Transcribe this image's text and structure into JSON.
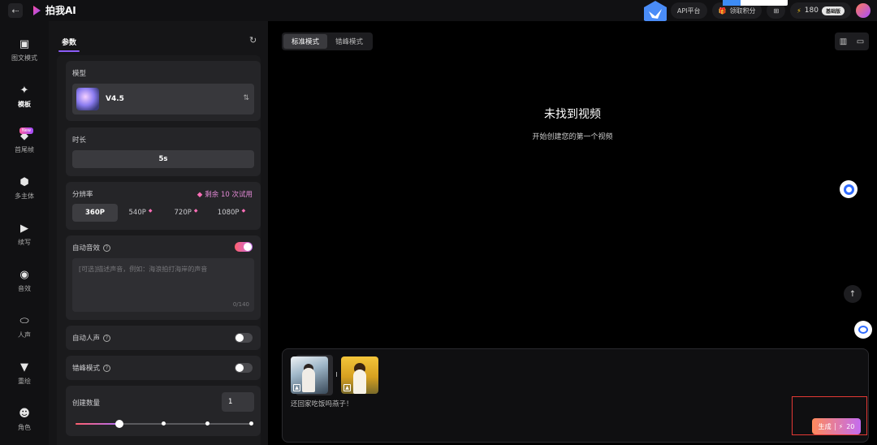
{
  "app": {
    "title": "拍我AI"
  },
  "top": {
    "api_label": "API平台",
    "gift_label": "领取积分",
    "credits": "180",
    "plan": "基础版",
    "colors": {
      "accent": "#8b5cf6",
      "gen_from": "#ff8a5b",
      "gen_to": "#c36cf0"
    }
  },
  "nav": {
    "items": [
      {
        "label": "图文模式",
        "icon": "image-icon"
      },
      {
        "label": "模板",
        "icon": "sparkle-icon"
      },
      {
        "label": "首尾帧",
        "icon": "diamond-icon",
        "tag": "New"
      },
      {
        "label": "多主体",
        "icon": "cube-icon"
      },
      {
        "label": "续写",
        "icon": "play-frame-icon"
      },
      {
        "label": "音效",
        "icon": "audio-icon"
      },
      {
        "label": "人声",
        "icon": "lips-icon"
      },
      {
        "label": "重绘",
        "icon": "brush-icon"
      },
      {
        "label": "角色",
        "icon": "face-icon"
      }
    ]
  },
  "panel": {
    "tab": "参数",
    "model": {
      "label": "模型",
      "name": "V4.5"
    },
    "duration": {
      "label": "时长",
      "value": "5s"
    },
    "resolution": {
      "label": "分辨率",
      "trial": "剩余 10 次试用",
      "options": [
        "360P",
        "540P",
        "720P",
        "1080P"
      ],
      "selected": "360P"
    },
    "auto_sound": {
      "label": "自动音效",
      "on": true,
      "placeholder": "[可选]描述声音，例如：海浪拍打海岸的声音",
      "count": "0/140"
    },
    "auto_voice": {
      "label": "自动人声",
      "on": false
    },
    "peak_mode": {
      "label": "错峰模式",
      "on": false
    },
    "quantity": {
      "label": "创建数量",
      "value": "1",
      "slider_fraction": 0.25
    }
  },
  "main": {
    "modes": [
      "标准模式",
      "错峰模式"
    ],
    "selected_mode": "标准模式",
    "empty_title": "未找到视频",
    "empty_subtitle": "开始创建您的第一个视频",
    "prompt": "还回家吃饭吗燕子！",
    "generate": {
      "label": "生成",
      "cost": "20"
    }
  }
}
